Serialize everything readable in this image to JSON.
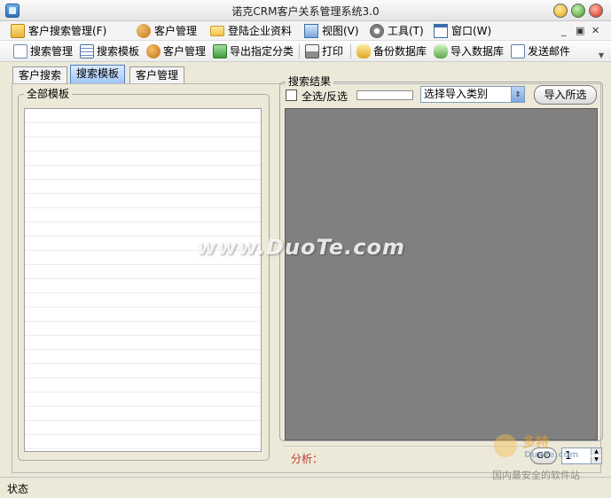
{
  "window": {
    "title": "诺克CRM客户关系管理系统3.0"
  },
  "menubar": {
    "items": [
      {
        "label": "客户搜索管理(F)",
        "icon": "folder-search-icon"
      },
      {
        "label": "客户管理",
        "icon": "users-icon"
      },
      {
        "label": "登陆企业资料",
        "icon": "folder-icon"
      },
      {
        "label": "视图(V)",
        "icon": "windows-icon"
      },
      {
        "label": "工具(T)",
        "icon": "gear-icon"
      },
      {
        "label": "窗口(W)",
        "icon": "window-icon"
      }
    ]
  },
  "toolbar": {
    "items": [
      {
        "label": "搜索管理",
        "icon": "search-manage-icon"
      },
      {
        "label": "搜索模板",
        "icon": "template-icon"
      },
      {
        "label": "客户管理",
        "icon": "users-icon"
      },
      {
        "label": "导出指定分类",
        "icon": "excel-icon"
      },
      {
        "label": "打印",
        "icon": "printer-icon"
      },
      {
        "label": "备份数据库",
        "icon": "database-backup-icon"
      },
      {
        "label": "导入数据库",
        "icon": "database-import-icon"
      },
      {
        "label": "发送邮件",
        "icon": "email-icon"
      }
    ]
  },
  "tabs": [
    {
      "label": "客户搜索",
      "active": false
    },
    {
      "label": "搜索模板",
      "active": true
    },
    {
      "label": "客户管理",
      "active": false
    }
  ],
  "left_panel": {
    "group_label": "全部模板"
  },
  "right_panel": {
    "group_label": "搜索结果",
    "select_all_label": "全选/反选",
    "select_all_checked": false,
    "progress": 0,
    "category_select_value": "选择导入类别",
    "import_button_label": "导入所选",
    "analysis_label": "分析：",
    "go_button_label": "GO",
    "page_number": "1"
  },
  "statusbar": {
    "text": "状态"
  },
  "watermark": {
    "text": "www.DuoTe.com",
    "corner_brand": "多特",
    "corner_en": "DuoTe.com",
    "corner_slogan": "国内最安全的软件站"
  },
  "colors": {
    "results_bg": "#808080",
    "active_tab": "#9cc4f5",
    "analysis_label": "#c0392b"
  }
}
